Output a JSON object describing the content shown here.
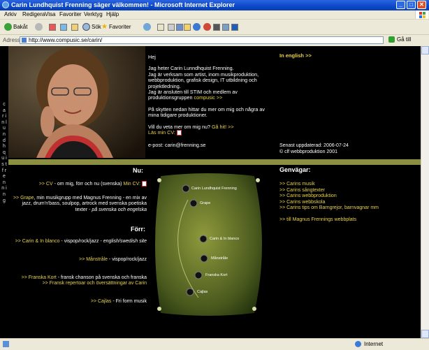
{
  "window": {
    "title": "Carin Lundhquist Frenning säger välkommen! - Microsoft Internet Explorer",
    "min": "_",
    "max": "□",
    "close": "✕"
  },
  "menu": [
    "Arkiv",
    "Redigera",
    "Visa",
    "Favoriter",
    "Verktyg",
    "Hjälp"
  ],
  "toolbar": {
    "back": "Bakåt",
    "search": "Sök",
    "favorites": "Favoriter"
  },
  "address": {
    "label": "Adress",
    "url": "http://www.compusic.se/carin/",
    "go": "Gå till"
  },
  "status": {
    "zone": "Internet"
  },
  "page": {
    "vertical_name": "c a r i n   l u n d h q u i s t   f r e n n i n g",
    "english_link": "In english >>",
    "intro": {
      "greeting": "Hej",
      "p1": "Jag heter Carin Lunndhquist Frenning.",
      "p2": "Jag är verksam som artist, inom musikproduktion, webbproduktion, grafisk design, IT utbildning och projektledning.",
      "p3": "Jag är ansluten till STIM och medlem av produktionsgruppen",
      "p3_link": "compusic >>",
      "p4": "På skytten nedan hittar du mer om mig och några av mina tidigare produktioner.",
      "cv_q": "Vill du veta mer om mig nu?",
      "cv_link1": "Gå hit! >>",
      "cv_link2": "Läs min CV:",
      "email": "e-post: carin@frenning.se"
    },
    "updated": "Senast uppdaterad: 2006-07-24",
    "copyright": "© clf webbproduktion 2001",
    "nu_heading": "Nu:",
    "nu_cv": {
      "link": ">> CV",
      "text": " - om mig, förr och nu (svenska)",
      "link2": "Min CV:"
    },
    "nu_grape": {
      "link": ">> Grape",
      "text": ", min musikgrupp med Magnus Frenning - en mix av jazz, drum'n'bass, soulpop, artrock med svenska poetiska texter -",
      "tail": "på svenska och engelska"
    },
    "forr_heading": "Förr:",
    "forr_inblanco": {
      "link": ">> Carin & In blanco",
      "text": " - vispop/rock/jazz -",
      "tail": "english/swedish site"
    },
    "forr_manstrale": {
      "link": ">> Månstråle",
      "text": " - vispop/rock/jazz"
    },
    "forr_franska": {
      "link": ">> Franska Kort",
      "text": " - fransk chanson på svenska och franska",
      "line2": ">> Fransk repertoar och översättningar av Carin"
    },
    "forr_cajlas": {
      "link": ">> Cajlas",
      "text": " - Fri form musik"
    },
    "disc_labels": [
      "Carin Lundhquist Frenning",
      "Grape",
      "Carin & In blanco",
      "Månstråle",
      "Franska Kort",
      "Cajlas"
    ],
    "genvagar_heading": "Genvägar:",
    "genvagar": [
      ">> Carins musik",
      ">> Carins sångtexter",
      ">> Carins webbproduktion",
      ">> Carins webbskola",
      ">> Carins tips om Barngrejor, barnvagnar mm"
    ],
    "genvagar_extra": ">> till Magnus Frennings webbplats"
  },
  "colors": {
    "accent": "#e8d24a",
    "bar": "#8a8f42",
    "bg": "#000000"
  }
}
